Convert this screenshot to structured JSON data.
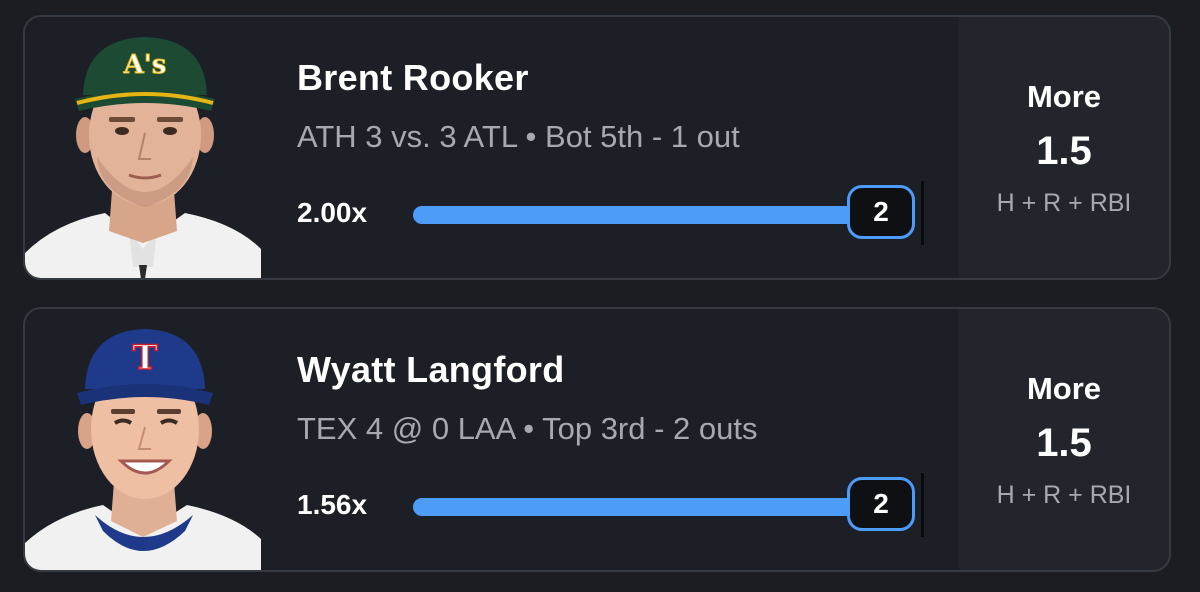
{
  "colors": {
    "background": "#1b1d22",
    "card": "#1c1f25",
    "card_border": "#363a42",
    "pick_panel": "#22262c",
    "progress_fill": "#4d9cf8",
    "progress_track": "#2c3037",
    "muted_text": "#a6a9b0"
  },
  "picks": [
    {
      "player": "Brent Rooker",
      "game": "ATH 3 vs. 3 ATL • Bot 5th  -  1 out",
      "multiplier": "2.00x",
      "current_value": "2",
      "progress": 1.0,
      "direction": "More",
      "line": "1.5",
      "stat": "H + R + RBI",
      "photo": {
        "icon": "player-headshot-athletics",
        "cap_color": "#1d4a33",
        "cap_brim": "#e6b413",
        "logo": "A's"
      }
    },
    {
      "player": "Wyatt Langford",
      "game": "TEX 4 @ 0 LAA • Top 3rd  -  2 outs",
      "multiplier": "1.56x",
      "current_value": "2",
      "progress": 1.0,
      "direction": "More",
      "line": "1.5",
      "stat": "H + R + RBI",
      "photo": {
        "icon": "player-headshot-rangers",
        "cap_color": "#1f3a8a",
        "cap_brim": "#1f3a8a",
        "logo": "T"
      }
    }
  ]
}
